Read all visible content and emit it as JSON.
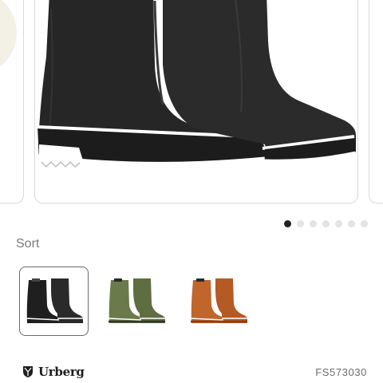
{
  "product": {
    "variant_label": "Sort",
    "variants": [
      {
        "name": "black",
        "color": "#1f1f1f",
        "selected": true
      },
      {
        "name": "green",
        "color": "#6a7a4a",
        "selected": false
      },
      {
        "name": "orange",
        "color": "#c0652c",
        "selected": false
      }
    ],
    "gallery": {
      "image_count": 7,
      "active_index": 0
    },
    "brand": "Urberg",
    "sku": "FS573030"
  },
  "icons": {
    "brand_logo": "shield-logo-icon"
  },
  "colors": {
    "border": "#d9d9d9",
    "selected_border": "#6a6a6a",
    "dot_active": "#222222",
    "dot_inactive": "#e3e3e3"
  }
}
